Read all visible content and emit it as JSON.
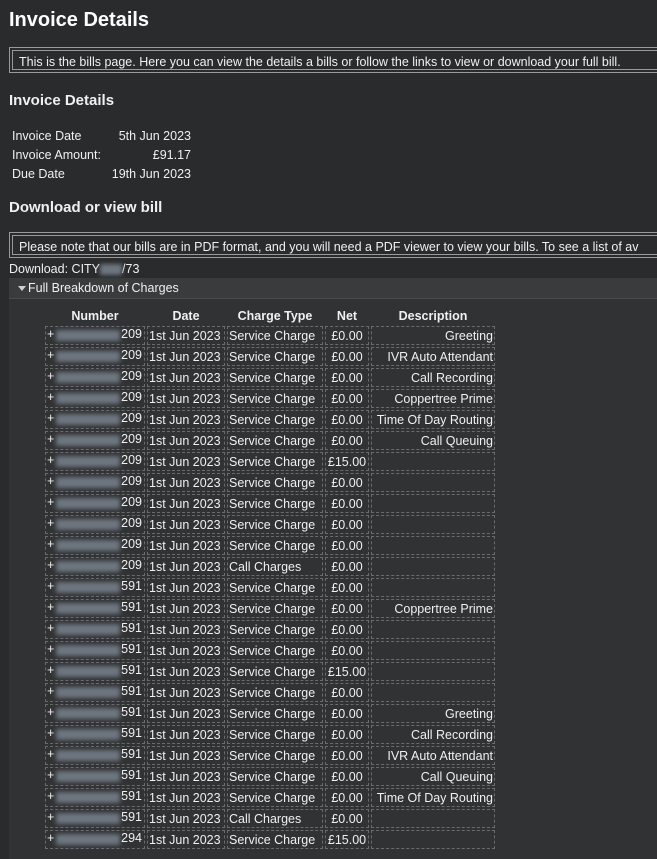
{
  "page": {
    "title": "Invoice Details",
    "intro": "This is the bills page. Here you can view the details a bills or follow the links to view or download your full bill."
  },
  "invoice_details": {
    "heading": "Invoice Details",
    "rows": [
      {
        "label": "Invoice Date",
        "value": "5th Jun 2023"
      },
      {
        "label": "Invoice Amount:",
        "value": "£91.17"
      },
      {
        "label": "Due Date",
        "value": "19th Jun 2023"
      }
    ]
  },
  "download": {
    "heading": "Download or view bill",
    "notice": "Please note that our bills are in PDF format, and you will need a PDF viewer to view your bills. To see a list of av",
    "link_prefix": "Download: CITY",
    "link_suffix": "/73"
  },
  "breakdown": {
    "label": "Full Breakdown of Charges",
    "columns": [
      "Number",
      "Date",
      "Charge Type",
      "Net",
      "Description"
    ],
    "rows": [
      {
        "plus": "+",
        "suffix": "209",
        "date": "1st Jun 2023",
        "type": "Service Charge",
        "net": "£0.00",
        "desc": "Greeting"
      },
      {
        "plus": "+",
        "suffix": "209",
        "date": "1st Jun 2023",
        "type": "Service Charge",
        "net": "£0.00",
        "desc": "IVR Auto Attendant"
      },
      {
        "plus": "+",
        "suffix": "209",
        "date": "1st Jun 2023",
        "type": "Service Charge",
        "net": "£0.00",
        "desc": "Call Recording"
      },
      {
        "plus": "+",
        "suffix": "209",
        "date": "1st Jun 2023",
        "type": "Service Charge",
        "net": "£0.00",
        "desc": "Coppertree Prime"
      },
      {
        "plus": "+",
        "suffix": "209",
        "date": "1st Jun 2023",
        "type": "Service Charge",
        "net": "£0.00",
        "desc": "Time Of Day Routing"
      },
      {
        "plus": "+",
        "suffix": "209",
        "date": "1st Jun 2023",
        "type": "Service Charge",
        "net": "£0.00",
        "desc": "Call Queuing"
      },
      {
        "plus": "+",
        "suffix": "209",
        "date": "1st Jun 2023",
        "type": "Service Charge",
        "net": "£15.00",
        "desc": ""
      },
      {
        "plus": "+",
        "suffix": "209",
        "date": "1st Jun 2023",
        "type": "Service Charge",
        "net": "£0.00",
        "desc": ""
      },
      {
        "plus": "+",
        "suffix": "209",
        "date": "1st Jun 2023",
        "type": "Service Charge",
        "net": "£0.00",
        "desc": ""
      },
      {
        "plus": "+",
        "suffix": "209",
        "date": "1st Jun 2023",
        "type": "Service Charge",
        "net": "£0.00",
        "desc": ""
      },
      {
        "plus": "+",
        "suffix": "209",
        "date": "1st Jun 2023",
        "type": "Service Charge",
        "net": "£0.00",
        "desc": ""
      },
      {
        "plus": "+",
        "suffix": "209",
        "date": "1st Jun 2023",
        "type": "Call Charges",
        "net": "£0.00",
        "desc": ""
      },
      {
        "plus": "+",
        "suffix": "591",
        "date": "1st Jun 2023",
        "type": "Service Charge",
        "net": "£0.00",
        "desc": ""
      },
      {
        "plus": "+",
        "suffix": "591",
        "date": "1st Jun 2023",
        "type": "Service Charge",
        "net": "£0.00",
        "desc": "Coppertree Prime"
      },
      {
        "plus": "+",
        "suffix": "591",
        "date": "1st Jun 2023",
        "type": "Service Charge",
        "net": "£0.00",
        "desc": ""
      },
      {
        "plus": "+",
        "suffix": "591",
        "date": "1st Jun 2023",
        "type": "Service Charge",
        "net": "£0.00",
        "desc": ""
      },
      {
        "plus": "+",
        "suffix": "591",
        "date": "1st Jun 2023",
        "type": "Service Charge",
        "net": "£15.00",
        "desc": ""
      },
      {
        "plus": "+",
        "suffix": "591",
        "date": "1st Jun 2023",
        "type": "Service Charge",
        "net": "£0.00",
        "desc": ""
      },
      {
        "plus": "+",
        "suffix": "591",
        "date": "1st Jun 2023",
        "type": "Service Charge",
        "net": "£0.00",
        "desc": "Greeting"
      },
      {
        "plus": "+",
        "suffix": "591",
        "date": "1st Jun 2023",
        "type": "Service Charge",
        "net": "£0.00",
        "desc": "Call Recording"
      },
      {
        "plus": "+",
        "suffix": "591",
        "date": "1st Jun 2023",
        "type": "Service Charge",
        "net": "£0.00",
        "desc": "IVR Auto Attendant"
      },
      {
        "plus": "+",
        "suffix": "591",
        "date": "1st Jun 2023",
        "type": "Service Charge",
        "net": "£0.00",
        "desc": "Call Queuing"
      },
      {
        "plus": "+",
        "suffix": "591",
        "date": "1st Jun 2023",
        "type": "Service Charge",
        "net": "£0.00",
        "desc": "Time Of Day Routing"
      },
      {
        "plus": "+",
        "suffix": "591",
        "date": "1st Jun 2023",
        "type": "Call Charges",
        "net": "£0.00",
        "desc": ""
      },
      {
        "plus": "+",
        "suffix": "294",
        "date": "1st Jun 2023",
        "type": "Service Charge",
        "net": "£15.00",
        "desc": ""
      }
    ]
  },
  "icons": {
    "expand": "triangle-down-icon"
  },
  "colors": {
    "background": "#2a2b2d",
    "text": "#f0f0f0",
    "border": "#9a9a9a"
  }
}
